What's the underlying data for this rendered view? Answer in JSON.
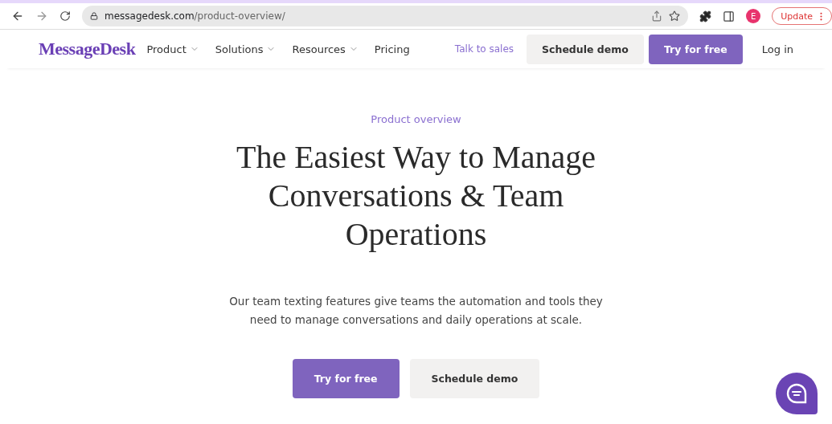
{
  "browser": {
    "url_host": "messagedesk.com",
    "url_path": "/product-overview/",
    "profile_initial": "E",
    "update_label": "Update"
  },
  "nav": {
    "logo": "MessageDesk",
    "menu": [
      {
        "label": "Product",
        "dropdown": true
      },
      {
        "label": "Solutions",
        "dropdown": true
      },
      {
        "label": "Resources",
        "dropdown": true
      },
      {
        "label": "Pricing",
        "dropdown": false
      }
    ],
    "talk_to_sales": "Talk to sales",
    "schedule_demo": "Schedule demo",
    "try_free": "Try for free",
    "login": "Log in"
  },
  "hero": {
    "eyebrow": "Product overview",
    "title": "The Easiest Way to Manage Conversations & Team Operations",
    "description": "Our team texting features give teams the automation and tools they need to manage conversations and daily operations at scale.",
    "primary_button": "Try for free",
    "secondary_button": "Schedule demo"
  }
}
